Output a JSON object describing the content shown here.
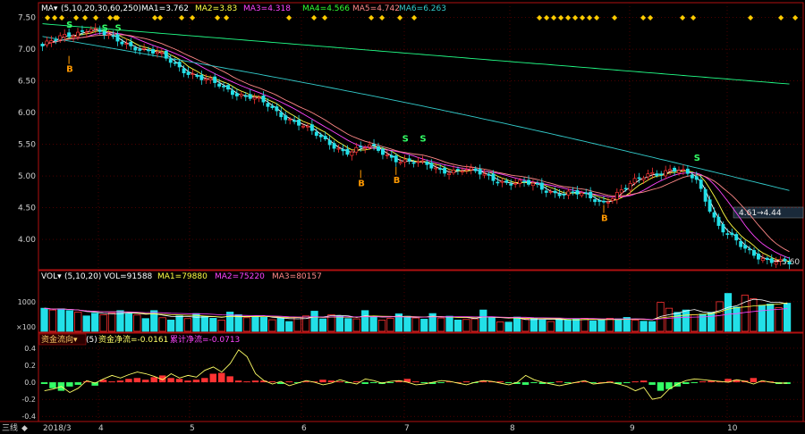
{
  "colors": {
    "bg": "#000000",
    "border": "#b01010",
    "grid": "#7a0000",
    "up": "#ff3333",
    "down": "#22e0e8",
    "axis_text": "#cfcfcf",
    "ma1": "#ffffff",
    "ma2": "#ffff44",
    "ma3": "#ff44ff",
    "ma4": "#33ff33",
    "ma5": "#ff8888",
    "ma6": "#33cccc",
    "ma7": "#22ff88",
    "signal_b": "#ff9900",
    "signal_s": "#33ff66",
    "diamond": "#ffcc00",
    "flow_line": "#ffff66"
  },
  "header_main": {
    "name": "MA▾",
    "params": "(5,10,20,30,60,250)",
    "ma1": "MA1=3.762",
    "ma2": "MA2=3.83",
    "ma3": "MA3=4.318",
    "ma4": "MA4=4.566",
    "ma5": "MA5=4.742",
    "ma6": "MA6=6.263"
  },
  "header_vol": {
    "name": "VOL▾",
    "params": "(5,10,20)",
    "vol": "VOL=91588",
    "ma1": "MA1=79880",
    "ma2": "MA2=75220",
    "ma3": "MA3=80157"
  },
  "header_flow": {
    "name": "资金流向▾",
    "params": "(5)",
    "net": "资金净流=-0.0161",
    "cum": "累计净流=-0.0713"
  },
  "bottom_left": "三线",
  "annotations": {
    "range_box": "4.61→4.44",
    "last_price": "3.60"
  },
  "chart_data": [
    {
      "type": "candlestick",
      "panel": "price",
      "y_ticks": [
        "7.50",
        "7.00",
        "6.50",
        "6.00",
        "5.50",
        "5.00",
        "4.50",
        "4.00"
      ],
      "ylim": [
        3.55,
        7.55
      ],
      "x_ticks": [
        "2018/3",
        "4",
        "5",
        "6",
        "7",
        "8",
        "9",
        "10"
      ],
      "close_keypoints": [
        7.05,
        7.2,
        7.35,
        7.15,
        7.05,
        6.9,
        6.7,
        6.5,
        6.35,
        6.25,
        6.0,
        5.85,
        5.55,
        5.4,
        5.45,
        5.3,
        5.2,
        5.1,
        5.1,
        5.0,
        4.9,
        4.85,
        4.75,
        4.7,
        4.6,
        4.8,
        5.05,
        5.1,
        4.95,
        4.2,
        3.85,
        3.7,
        3.6
      ],
      "signals": [
        {
          "type": "S",
          "value": 7.3
        },
        {
          "type": "B",
          "value": 6.95
        },
        {
          "type": "S",
          "value": 7.25
        },
        {
          "type": "S",
          "value": 7.25
        },
        {
          "type": "B",
          "value": 5.15
        },
        {
          "type": "S",
          "value": 5.5
        },
        {
          "type": "S",
          "value": 5.5
        },
        {
          "type": "B",
          "value": 5.2
        },
        {
          "type": "B",
          "value": 4.6
        },
        {
          "type": "S",
          "value": 5.2
        }
      ]
    },
    {
      "type": "bar",
      "panel": "volume",
      "y_ticks": [
        "1000",
        "×100"
      ],
      "ylim": [
        0,
        1600
      ],
      "values": [
        780,
        720,
        760,
        700,
        650,
        520,
        610,
        560,
        620,
        700,
        600,
        550,
        430,
        700,
        460,
        380,
        520,
        430,
        600,
        500,
        440,
        380,
        650,
        560,
        460,
        500,
        470,
        390,
        450,
        330,
        470,
        520,
        680,
        420,
        560,
        510,
        430,
        420,
        700,
        490,
        380,
        440,
        590,
        510,
        450,
        410,
        600,
        450,
        510,
        380,
        400,
        420,
        720,
        470,
        320,
        310,
        480,
        420,
        450,
        380,
        330,
        410,
        400,
        410,
        440,
        350,
        380,
        440,
        420,
        470,
        380,
        340,
        330,
        980,
        780,
        640,
        720,
        560,
        580,
        640,
        1000,
        1280,
        820,
        1220,
        1100,
        880,
        920,
        800,
        950
      ]
    },
    {
      "type": "bar",
      "panel": "money_flow",
      "y_ticks": [
        "0.4",
        "0.2",
        "0.0",
        "-0.2",
        "-0.4"
      ],
      "ylim": [
        -0.45,
        0.42
      ],
      "values": [
        -0.02,
        -0.07,
        -0.1,
        -0.05,
        -0.03,
        0.01,
        -0.04,
        0.03,
        0.01,
        0.02,
        0.04,
        0.05,
        0.03,
        0.06,
        0.08,
        0.05,
        0.04,
        0.02,
        0.03,
        0.05,
        0.1,
        0.11,
        0.07,
        0.02,
        0.01,
        0.02,
        0.02,
        0.01,
        -0.02,
        0.01,
        -0.01,
        0.01,
        0.01,
        0.03,
        0.02,
        0.01,
        -0.01,
        0.01,
        -0.02,
        -0.01,
        -0.02,
        -0.01,
        0.02,
        0.04,
        0.01,
        -0.01,
        -0.02,
        -0.01,
        0.01,
        0.0,
        0.01,
        -0.01,
        0.02,
        0.01,
        0.01,
        -0.01,
        -0.02,
        -0.03,
        -0.01,
        -0.02,
        -0.01,
        0.01,
        -0.01,
        0.0,
        0.01,
        -0.01,
        0.0,
        0.01,
        -0.02,
        -0.01,
        0.01,
        0.02,
        -0.03,
        -0.1,
        -0.08,
        -0.05,
        -0.02,
        -0.01,
        0.01,
        0.02,
        0.01,
        0.04,
        0.03,
        0.02,
        0.05,
        0.01,
        0.01,
        -0.02,
        -0.02
      ],
      "cumulative": [
        -0.1,
        -0.08,
        -0.05,
        -0.12,
        -0.07,
        0.02,
        -0.01,
        0.04,
        0.08,
        0.05,
        0.09,
        0.12,
        0.1,
        0.07,
        0.03,
        0.1,
        0.05,
        0.08,
        0.06,
        0.14,
        0.18,
        0.12,
        0.22,
        0.38,
        0.3,
        0.1,
        0.02,
        -0.02,
        0.01,
        -0.04,
        -0.01,
        0.02,
        0.0,
        -0.03,
        -0.01,
        0.03,
        0.0,
        -0.02,
        0.04,
        0.02,
        -0.01,
        0.01,
        0.02,
        0.0,
        -0.03,
        -0.02,
        0.0,
        0.02,
        0.01,
        -0.01,
        -0.03,
        0.0,
        0.02,
        0.01,
        -0.01,
        -0.03,
        0.0,
        0.08,
        0.03,
        0.0,
        -0.02,
        -0.04,
        -0.02,
        0.0,
        0.02,
        -0.02,
        -0.01,
        0.0,
        -0.02,
        -0.05,
        -0.1,
        -0.06,
        -0.2,
        -0.18,
        -0.08,
        -0.02,
        0.02,
        0.04,
        0.03,
        0.02,
        0.01,
        0.0,
        0.03,
        0.01,
        -0.02,
        0.02,
        0.0,
        -0.01,
        -0.01
      ]
    }
  ]
}
